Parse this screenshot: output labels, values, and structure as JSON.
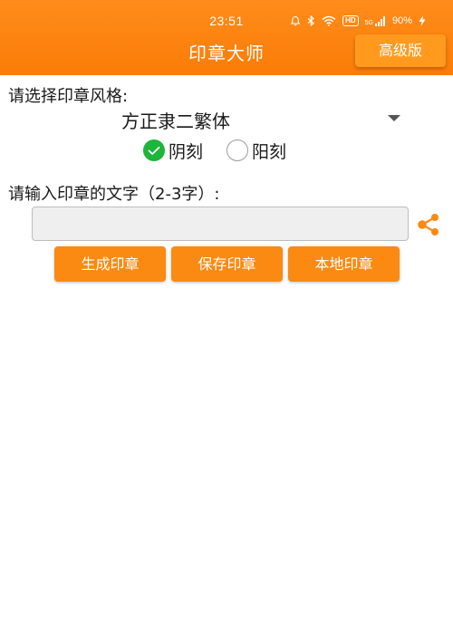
{
  "status_bar": {
    "time": "23:51",
    "hd": "HD",
    "network": "5G",
    "battery": "90%"
  },
  "header": {
    "title": "印章大师",
    "pro_label": "高级版"
  },
  "style": {
    "label": "请选择印章风格:",
    "font_value": "方正隶二繁体",
    "carve_options": [
      {
        "label": "阴刻",
        "selected": true
      },
      {
        "label": "阳刻",
        "selected": false
      }
    ]
  },
  "text_entry": {
    "label": "请输入印章的文字（2-3字）:",
    "value": "",
    "placeholder": ""
  },
  "actions": {
    "generate": "生成印章",
    "save": "保存印章",
    "local": "本地印章"
  },
  "colors": {
    "accent": "#fa8a12",
    "check": "#1db53a"
  },
  "icons": {
    "share": "share-icon"
  }
}
